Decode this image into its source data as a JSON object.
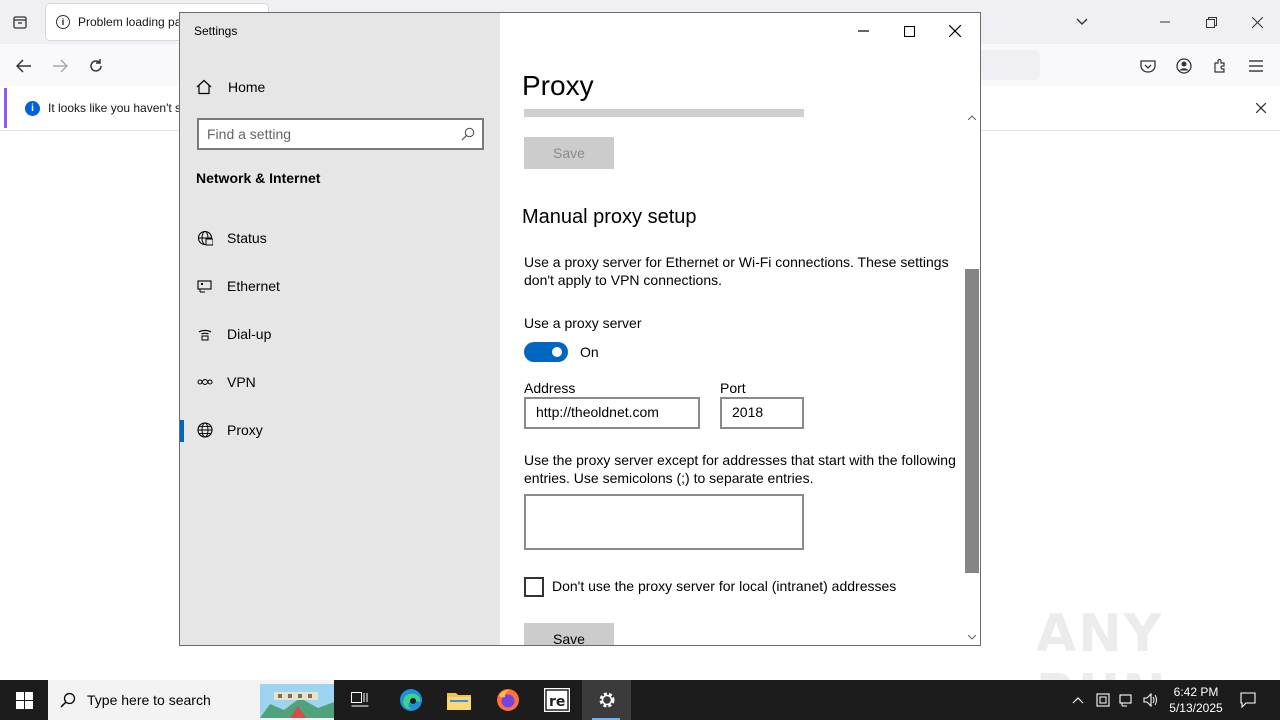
{
  "browser": {
    "tab_title": "Problem loading pa",
    "notification_text": "It looks like you haven't st"
  },
  "settings": {
    "window_title": "Settings",
    "sidebar": {
      "home_label": "Home",
      "search_placeholder": "Find a setting",
      "section_title": "Network & Internet",
      "items": [
        {
          "label": "Status",
          "icon": "globe-status-icon"
        },
        {
          "label": "Ethernet",
          "icon": "ethernet-icon"
        },
        {
          "label": "Dial-up",
          "icon": "dialup-icon"
        },
        {
          "label": "VPN",
          "icon": "vpn-icon"
        },
        {
          "label": "Proxy",
          "icon": "globe-icon",
          "selected": true
        }
      ]
    },
    "content": {
      "heading": "Proxy",
      "save_top_label": "Save",
      "manual_heading": "Manual proxy setup",
      "manual_description": "Use a proxy server for Ethernet or Wi-Fi connections. These settings don't apply to VPN connections.",
      "use_proxy_label": "Use a proxy server",
      "toggle_state": "On",
      "address_label": "Address",
      "address_value": "http://theoldnet.com",
      "port_label": "Port",
      "port_value": "2018",
      "exceptions_description": "Use the proxy server except for addresses that start with the following entries. Use semicolons (;) to separate entries.",
      "exceptions_value": "",
      "local_checkbox_label": "Don't use the proxy server for local (intranet) addresses",
      "local_checkbox_checked": false,
      "save_bottom_label": "Save"
    }
  },
  "taskbar": {
    "search_placeholder": "Type here to search",
    "time": "6:42 PM",
    "date": "5/13/2025"
  },
  "watermark": "ANY RUN",
  "colors": {
    "accent": "#0067c0",
    "sidebar_bg": "#e6e6e6",
    "taskbar_bg": "#1c1c1c",
    "button_bg": "#cccccc"
  }
}
